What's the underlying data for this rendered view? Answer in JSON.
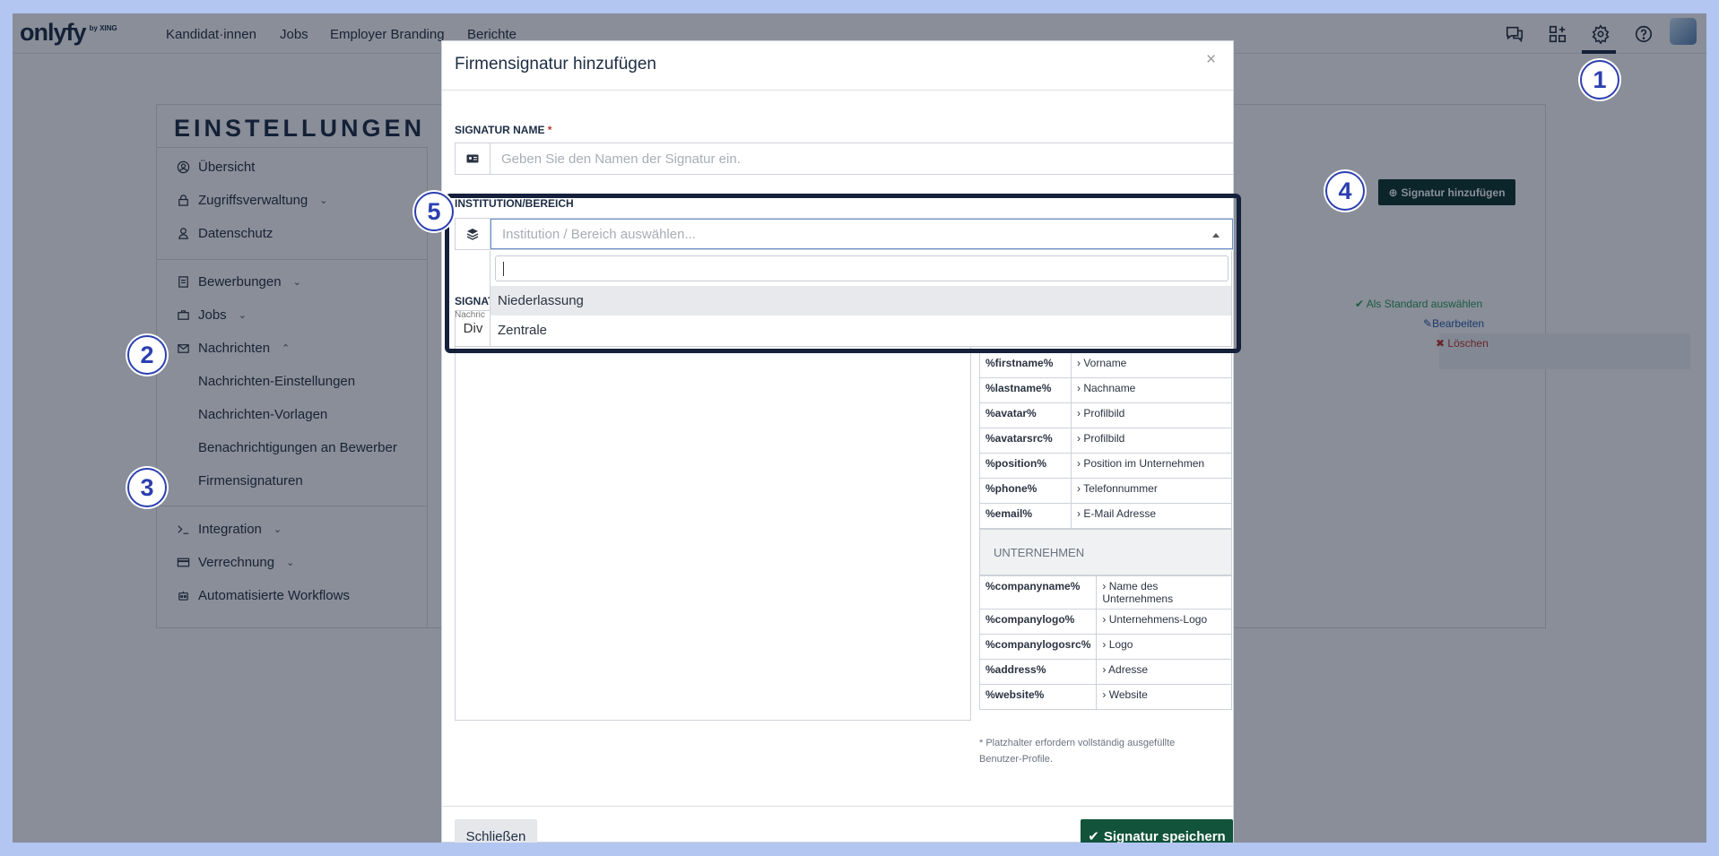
{
  "nav": {
    "logo": "onlyfy",
    "logo_sub": "by XING",
    "items": [
      "Kandidat·innen",
      "Jobs",
      "Employer Branding",
      "Berichte"
    ]
  },
  "settings": {
    "title": "EINSTELLUNGEN",
    "sidebar": {
      "overview": "Übersicht",
      "access": "Zugriffsverwaltung",
      "privacy": "Datenschutz",
      "applications": "Bewerbungen",
      "jobs": "Jobs",
      "messages": "Nachrichten",
      "message_settings": "Nachrichten-Einstellungen",
      "message_templates": "Nachrichten-Vorlagen",
      "notifications": "Benachrichtigungen an Bewerber",
      "signatures": "Firmensignaturen",
      "integration": "Integration",
      "billing": "Verrechnung",
      "workflows": "Automatisierte Workflows"
    },
    "add_signature_button": "Signatur hinzufügen",
    "row_actions": {
      "set_default": "Als Standard auswählen",
      "edit": "Bearbeiten",
      "delete": "Löschen"
    }
  },
  "badges": [
    "1",
    "2",
    "3",
    "4",
    "5"
  ],
  "modal": {
    "title": "Firmensignatur hinzufügen",
    "close_symbol": "×",
    "signature_name_label": "SIGNATUR NAME",
    "required_mark": "*",
    "signature_name_placeholder": "Geben Sie den Namen der Signatur ein.",
    "institution_label": "INSTITUTION/BEREICH",
    "institution_placeholder": "Institution / Bereich auswählen...",
    "institution_options": [
      "Niederlassung",
      "Zentrale"
    ],
    "signature_label_partial": "SIGNAT",
    "signature_sub_partial": "Nachric",
    "editor_button": "Div",
    "placeholders_personal": [
      {
        "key": "%firstname%",
        "value": "Vorname"
      },
      {
        "key": "%lastname%",
        "value": "Nachname"
      },
      {
        "key": "%avatar%",
        "value": "Profilbild"
      },
      {
        "key": "%avatarsrc%",
        "value": "Profilbild"
      },
      {
        "key": "%position%",
        "value": "Position im Unternehmen"
      },
      {
        "key": "%phone%",
        "value": "Telefonnummer"
      },
      {
        "key": "%email%",
        "value": "E-Mail Adresse"
      }
    ],
    "company_section": "UNTERNEHMEN",
    "placeholders_company": [
      {
        "key": "%companyname%",
        "value": "Name des Unternehmens"
      },
      {
        "key": "%companylogo%",
        "value": "Unternehmens-Logo"
      },
      {
        "key": "%companylogosrc%",
        "value": "Logo"
      },
      {
        "key": "%address%",
        "value": "Adresse"
      },
      {
        "key": "%website%",
        "value": "Website"
      }
    ],
    "footnote": "* Platzhalter erfordern vollständig ausgefüllte Benutzer-Profile.",
    "close_button": "Schließen",
    "save_button": "Signatur speichern"
  },
  "colors": {
    "primary_dark": "#1d2d44",
    "save_green": "#11533b",
    "badge_blue": "#2c3fb0"
  }
}
